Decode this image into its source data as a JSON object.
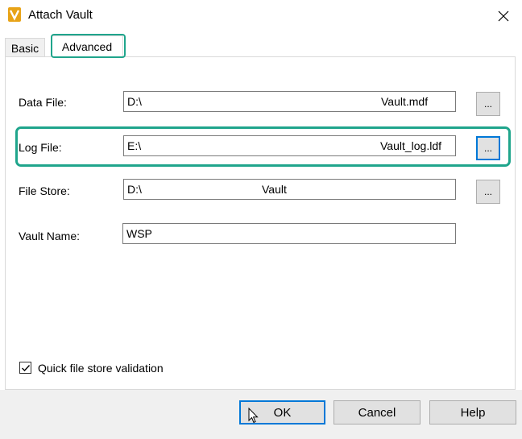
{
  "window": {
    "title": "Attach Vault",
    "icon": "autodesk-vault-logo-icon",
    "logo_text": "V"
  },
  "tabs": [
    {
      "label": "Basic",
      "selected": false
    },
    {
      "label": "Advanced",
      "selected": true
    }
  ],
  "fields": {
    "data_file": {
      "label": "Data File:",
      "prefix": "D:\\",
      "suffix": "Vault.mdf",
      "browse_label": "..."
    },
    "log_file": {
      "label": "Log File:",
      "prefix": "E:\\",
      "suffix": "Vault_log.ldf",
      "browse_label": "..."
    },
    "file_store": {
      "label": "File Store:",
      "prefix": "D:\\",
      "suffix": "Vault",
      "browse_label": "..."
    },
    "vault_name": {
      "label": "Vault Name:",
      "value": "WSP"
    }
  },
  "options": {
    "quick_validation_label": "Quick file store validation",
    "quick_validation_checked": true
  },
  "buttons": {
    "ok": "OK",
    "cancel": "Cancel",
    "help": "Help"
  },
  "colors": {
    "highlight": "#1fa58c",
    "focus": "#0078d7",
    "logo": "#e8a317"
  }
}
